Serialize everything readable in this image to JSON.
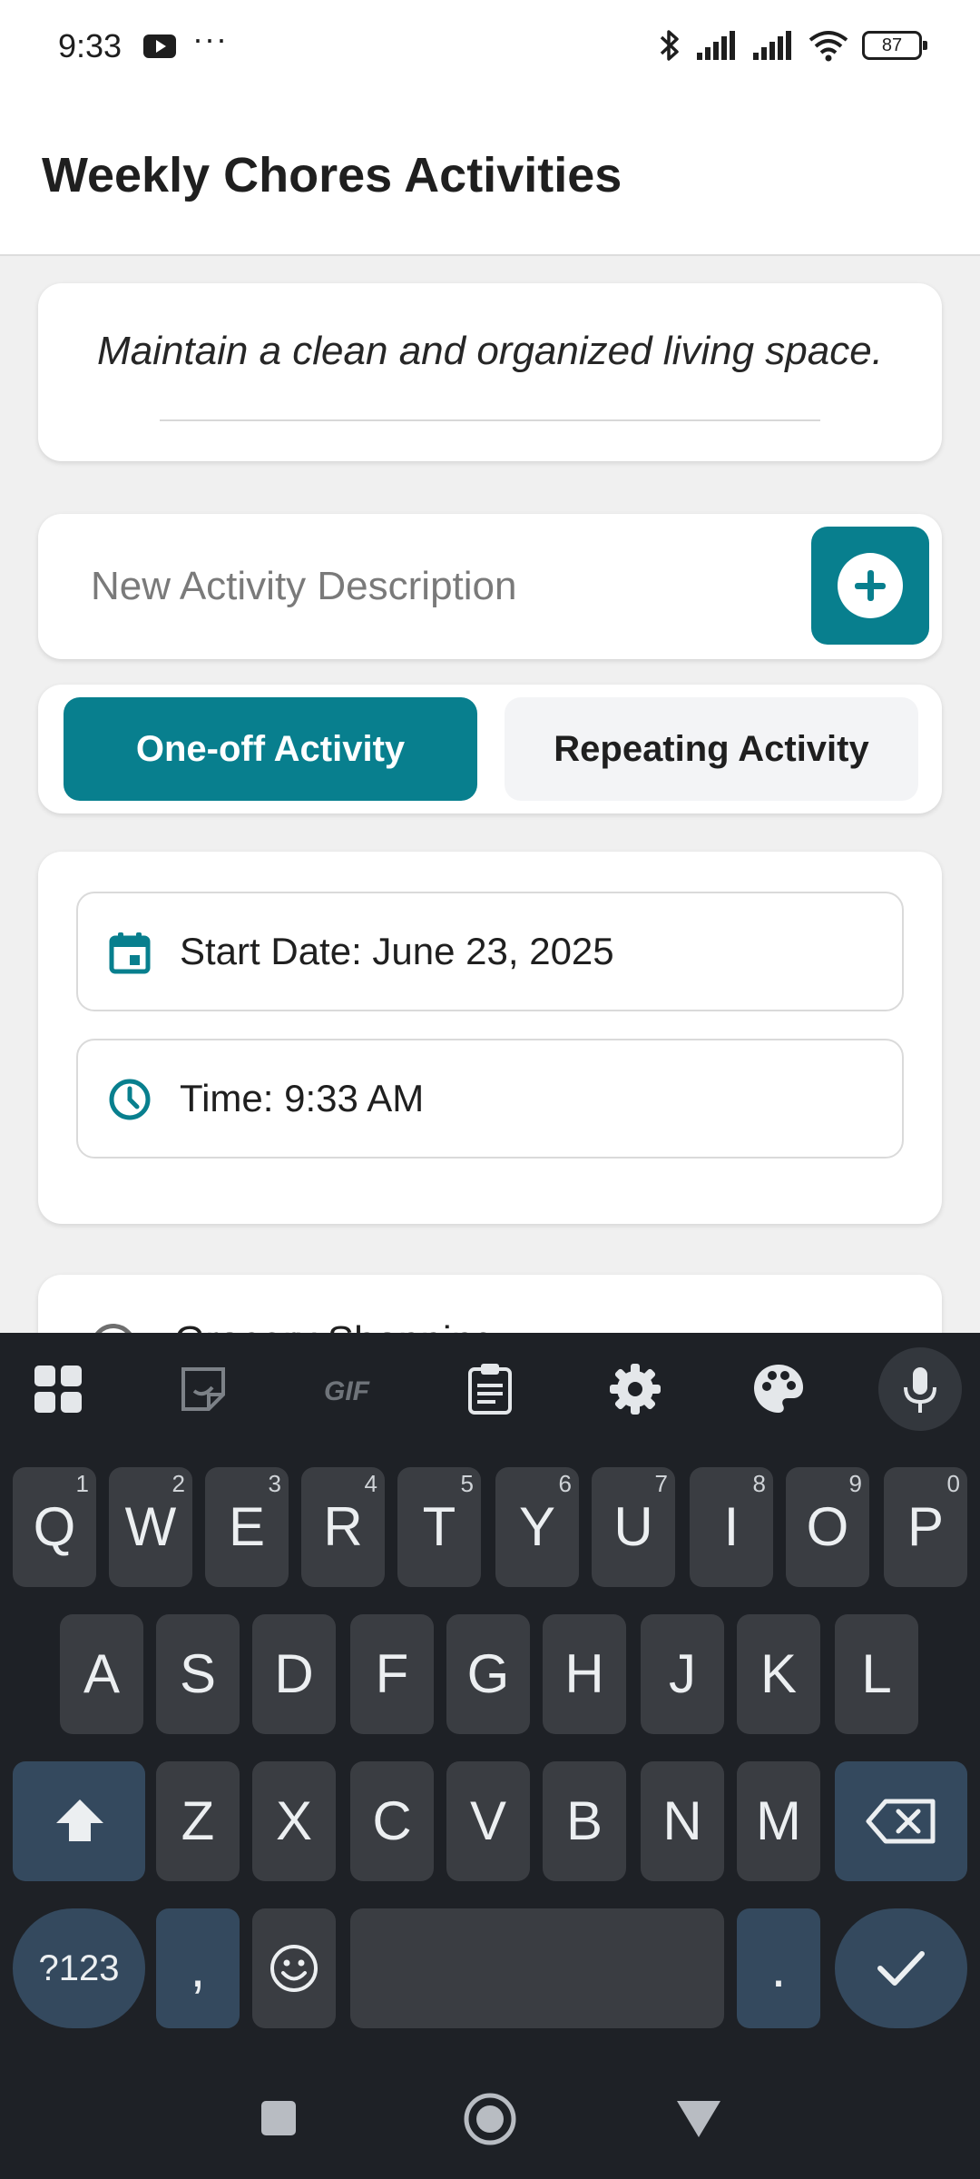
{
  "status_bar": {
    "time": "9:33",
    "dots": "···",
    "battery": "87"
  },
  "app": {
    "title": "Weekly Chores Activities"
  },
  "goal": {
    "text": "Maintain a clean and organized living space."
  },
  "new_activity": {
    "placeholder": "New Activity Description"
  },
  "activity_type": {
    "options": [
      "One-off Activity",
      "Repeating Activity"
    ],
    "selected": "One-off Activity"
  },
  "schedule": {
    "start_date": "Start Date: June 23, 2025",
    "time": "Time: 9:33 AM"
  },
  "activity_list": {
    "items": [
      {
        "label": "Grocery Shopping"
      }
    ]
  },
  "keyboard": {
    "row1": [
      {
        "k": "Q",
        "h": "1"
      },
      {
        "k": "W",
        "h": "2"
      },
      {
        "k": "E",
        "h": "3"
      },
      {
        "k": "R",
        "h": "4"
      },
      {
        "k": "T",
        "h": "5"
      },
      {
        "k": "Y",
        "h": "6"
      },
      {
        "k": "U",
        "h": "7"
      },
      {
        "k": "I",
        "h": "8"
      },
      {
        "k": "O",
        "h": "9"
      },
      {
        "k": "P",
        "h": "0"
      }
    ],
    "row2": [
      "A",
      "S",
      "D",
      "F",
      "G",
      "H",
      "J",
      "K",
      "L"
    ],
    "row3": [
      "Z",
      "X",
      "C",
      "V",
      "B",
      "N",
      "M"
    ],
    "symbols": "?123",
    "comma": ",",
    "period": "."
  }
}
